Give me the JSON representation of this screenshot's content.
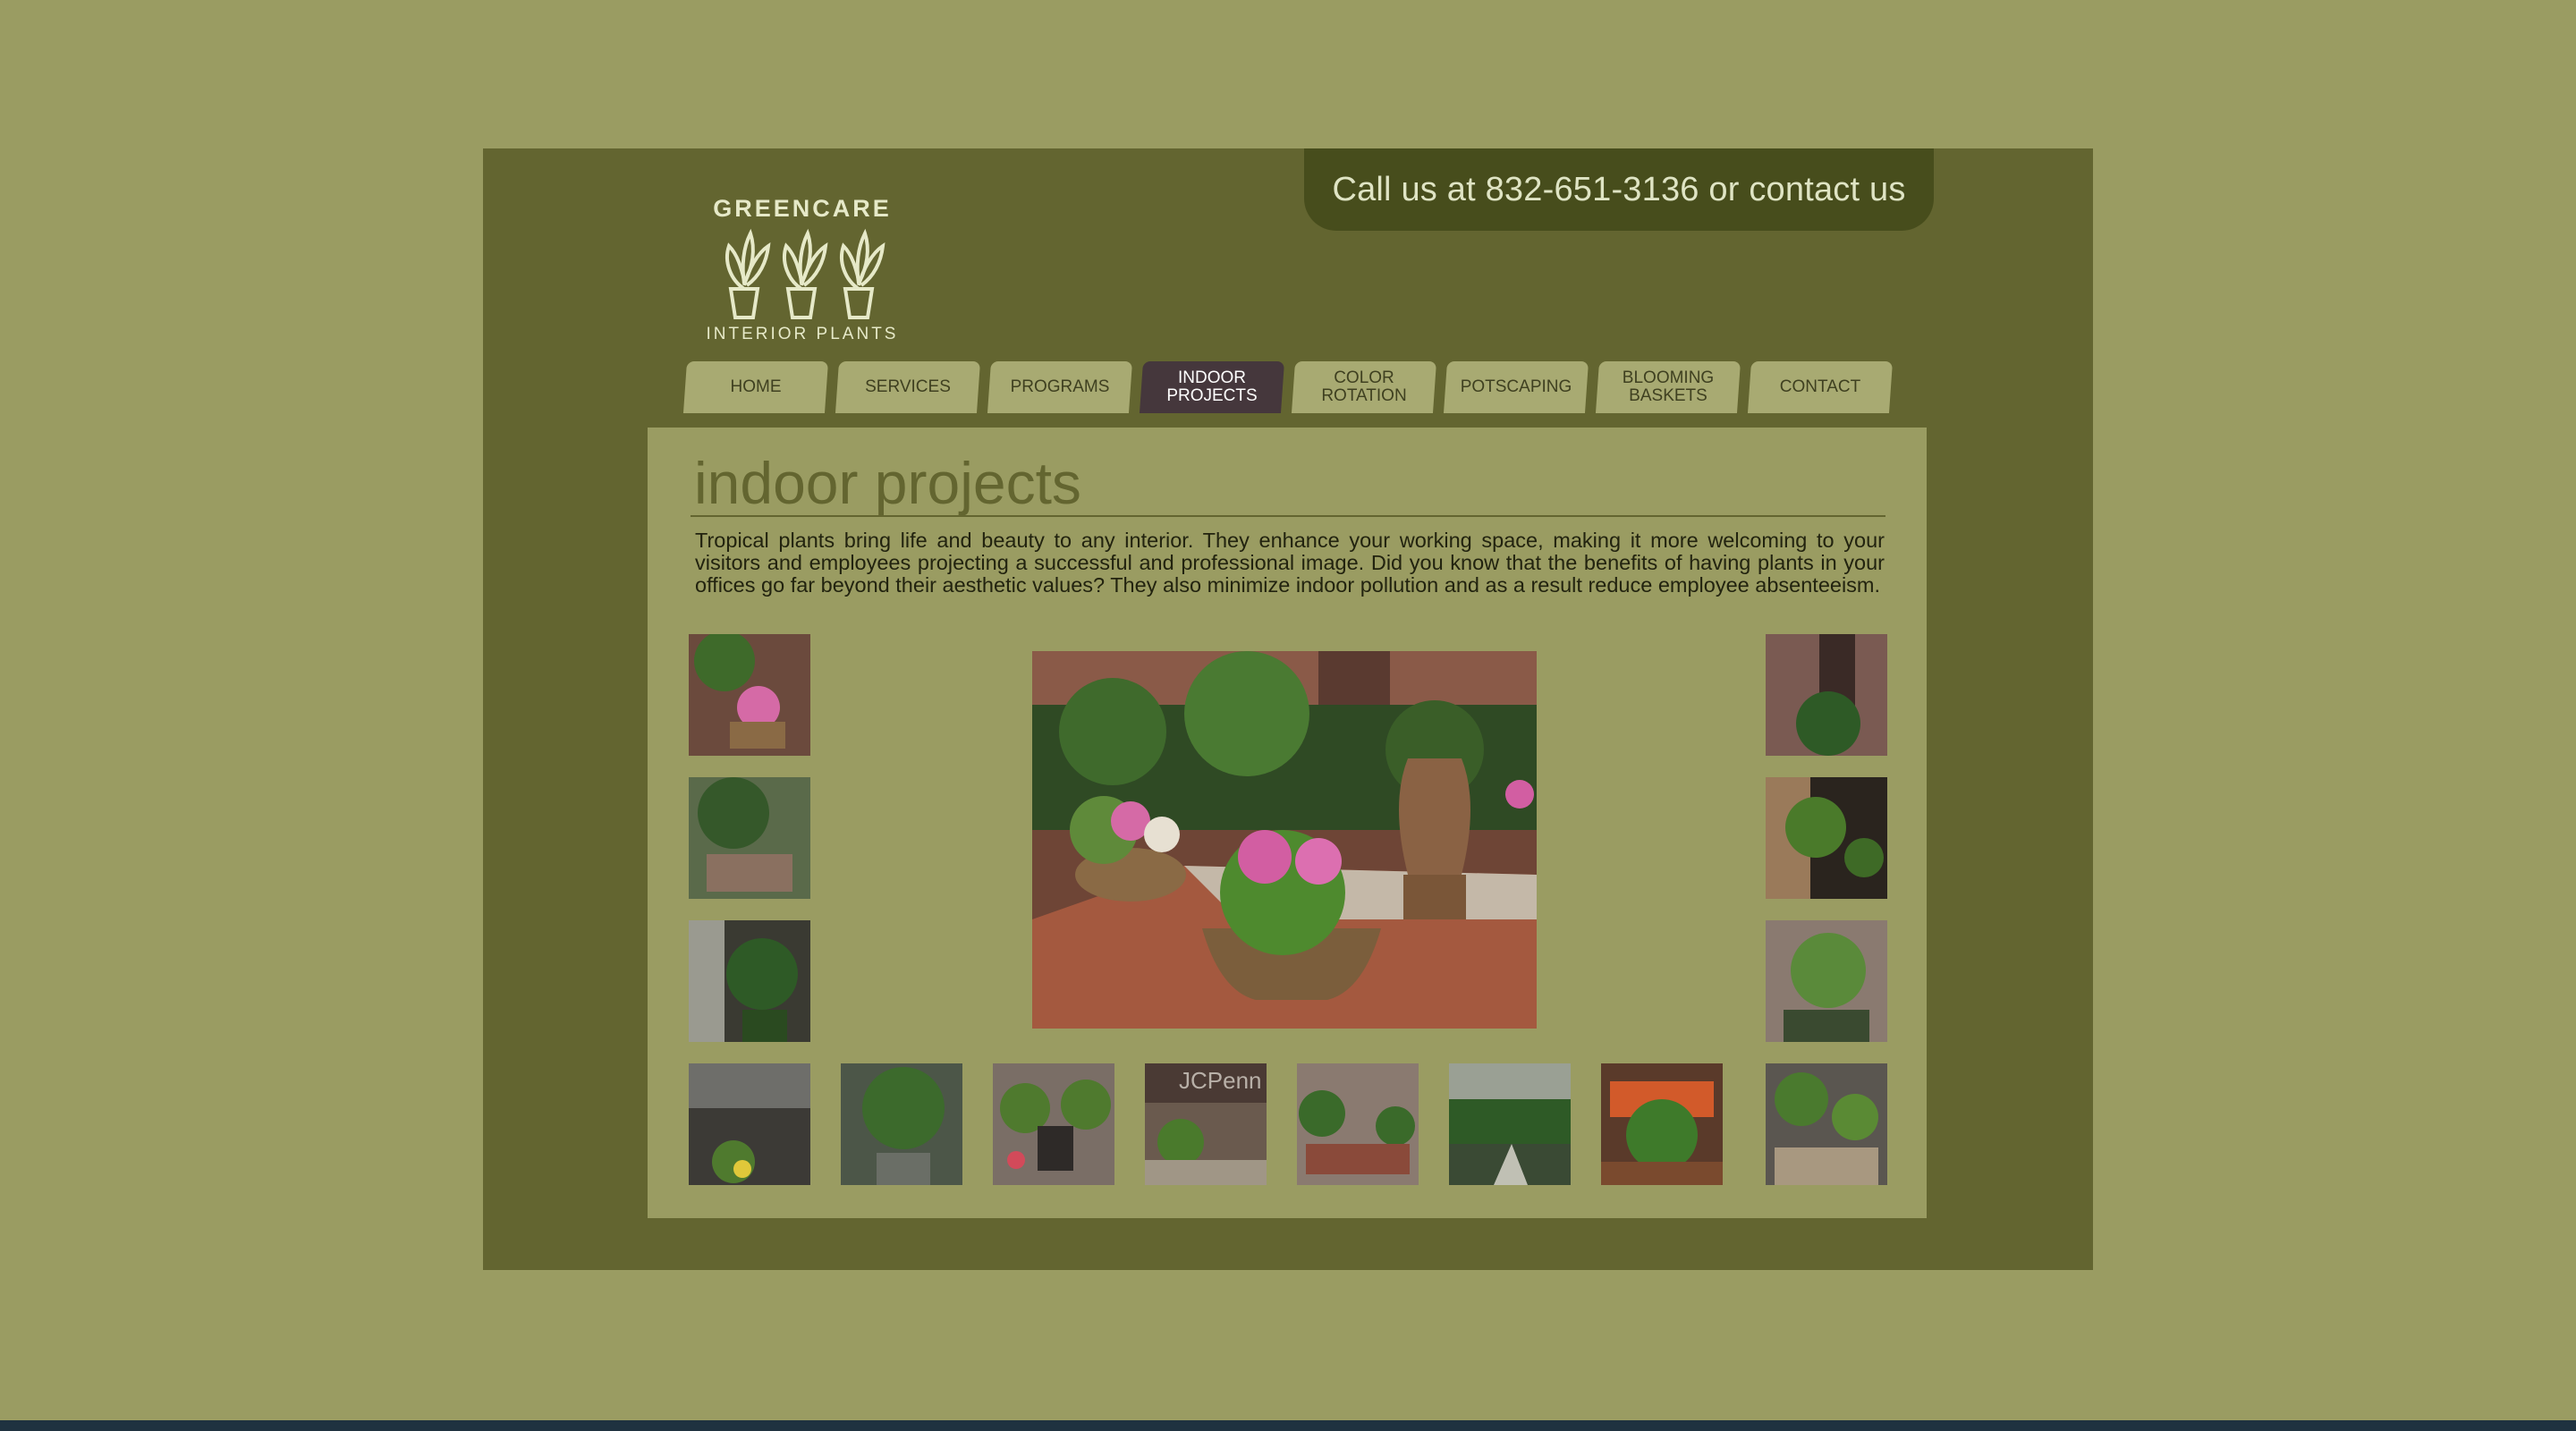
{
  "header": {
    "call_text": "Call us at 832-651-3136 or contact us"
  },
  "logo": {
    "top_text": "GREENCARE",
    "bottom_text": "INTERIOR PLANTS"
  },
  "nav": {
    "tabs": [
      {
        "line1": "HOME",
        "line2": ""
      },
      {
        "line1": "SERVICES",
        "line2": ""
      },
      {
        "line1": "PROGRAMS",
        "line2": ""
      },
      {
        "line1": "INDOOR",
        "line2": "PROJECTS"
      },
      {
        "line1": "COLOR",
        "line2": "ROTATION"
      },
      {
        "line1": "POTSCAPING",
        "line2": ""
      },
      {
        "line1": "BLOOMING",
        "line2": "BASKETS"
      },
      {
        "line1": "CONTACT",
        "line2": ""
      }
    ],
    "active": "INDOOR PROJECTS"
  },
  "main": {
    "title": "indoor projects",
    "intro": "Tropical plants bring life and beauty to any interior. They enhance your working space, making it more welcoming to your visitors and employees projecting a successful and professional image. Did you know that the benefits of having plants in your offices go far beyond their aesthetic values? They also minimize indoor pollution and as a result reduce employee absenteeism.",
    "jcpenney_sign": "JCPenn"
  },
  "colors": {
    "page_bg": "#9a9c62",
    "site_bg": "#636530",
    "callbar_bg": "#474d1c",
    "tab_bg": "#a8aa72",
    "tab_active_bg": "#45373c",
    "title_color": "#636530"
  }
}
